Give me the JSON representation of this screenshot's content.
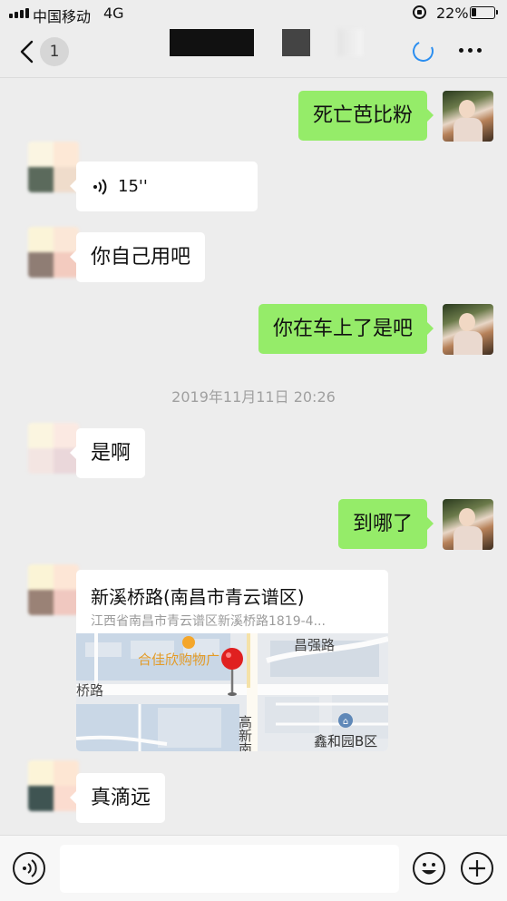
{
  "status_bar": {
    "carrier": "中国移动",
    "network": "4G",
    "battery_percent": "22%",
    "battery_level": 0.22
  },
  "nav": {
    "unread_count": "1"
  },
  "messages": [
    {
      "from": "me",
      "text": "死亡芭比粉"
    },
    {
      "from": "them",
      "type": "voice",
      "duration": "15''"
    },
    {
      "from": "them",
      "text": "你自己用吧"
    },
    {
      "from": "me",
      "text": "你在车上了是吧"
    },
    {
      "type": "timestamp",
      "text": "2019年11月11日 20:26"
    },
    {
      "from": "them",
      "text": "是啊"
    },
    {
      "from": "me",
      "text": "到哪了"
    },
    {
      "from": "them",
      "type": "location",
      "title": "新溪桥路(南昌市青云谱区)",
      "address": "江西省南昌市青云谱区新溪桥路1819-4...",
      "map_labels": {
        "poi_mall": "合佳欣购物广",
        "road_top": "昌强路",
        "road_left": "桥路",
        "road_vertical": "高新南",
        "area": "鑫和园B区"
      }
    },
    {
      "from": "them",
      "text": "真滴远"
    }
  ],
  "colors": {
    "my_bubble": "#95ec69",
    "their_bubble": "#ffffff",
    "background": "#ededed",
    "loading_spinner": "#2b8ef0"
  },
  "icons": [
    "back-chevron-icon",
    "loading-spinner-icon",
    "more-icon",
    "voice-wave-icon",
    "map-pin-icon",
    "voice-mode-icon",
    "emoji-icon",
    "plus-icon"
  ]
}
